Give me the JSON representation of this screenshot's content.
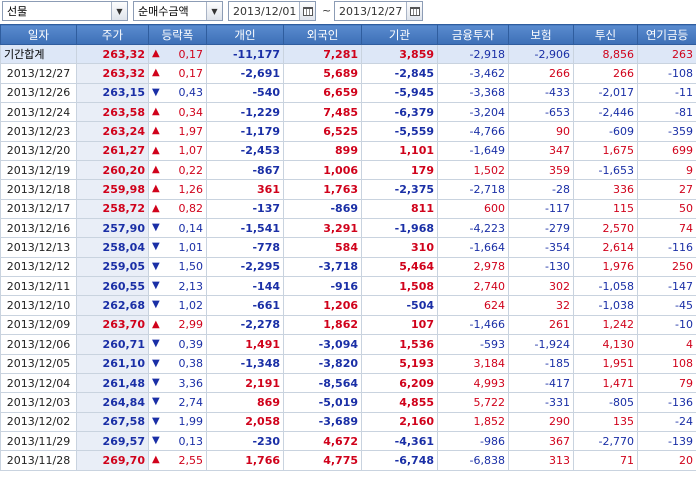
{
  "toolbar": {
    "market": "선물",
    "metric": "순매수금액",
    "date_from": "2013/12/01",
    "date_sep": "~",
    "date_to": "2013/12/27"
  },
  "columns": [
    "일자",
    "주가",
    "등락폭",
    "개인",
    "외국인",
    "기관",
    "금융투자",
    "보험",
    "투신",
    "연기금등"
  ],
  "total_row": {
    "date": "기간합계",
    "price": "263,32",
    "dir": "up",
    "chg": "0,17",
    "indiv": "-11,177",
    "foreign": "7,281",
    "inst": "3,859",
    "fin": "-2,918",
    "ins": "-2,906",
    "trust": "8,856",
    "pension": "263"
  },
  "rows": [
    {
      "date": "2013/12/27",
      "price": "263,32",
      "dir": "up",
      "chg": "0,17",
      "indiv": "-2,691",
      "foreign": "5,689",
      "inst": "-2,845",
      "fin": "-3,462",
      "ins": "266",
      "trust": "266",
      "pension": "-108"
    },
    {
      "date": "2013/12/26",
      "price": "263,15",
      "dir": "dn",
      "chg": "0,43",
      "indiv": "-540",
      "foreign": "6,659",
      "inst": "-5,945",
      "fin": "-3,368",
      "ins": "-433",
      "trust": "-2,017",
      "pension": "-11"
    },
    {
      "date": "2013/12/24",
      "price": "263,58",
      "dir": "up",
      "chg": "0,34",
      "indiv": "-1,229",
      "foreign": "7,485",
      "inst": "-6,379",
      "fin": "-3,204",
      "ins": "-653",
      "trust": "-2,446",
      "pension": "-81"
    },
    {
      "date": "2013/12/23",
      "price": "263,24",
      "dir": "up",
      "chg": "1,97",
      "indiv": "-1,179",
      "foreign": "6,525",
      "inst": "-5,559",
      "fin": "-4,766",
      "ins": "90",
      "trust": "-609",
      "pension": "-359"
    },
    {
      "date": "2013/12/20",
      "price": "261,27",
      "dir": "up",
      "chg": "1,07",
      "indiv": "-2,453",
      "foreign": "899",
      "inst": "1,101",
      "fin": "-1,649",
      "ins": "347",
      "trust": "1,675",
      "pension": "699"
    },
    {
      "date": "2013/12/19",
      "price": "260,20",
      "dir": "up",
      "chg": "0,22",
      "indiv": "-867",
      "foreign": "1,006",
      "inst": "179",
      "fin": "1,502",
      "ins": "359",
      "trust": "-1,653",
      "pension": "9"
    },
    {
      "date": "2013/12/18",
      "price": "259,98",
      "dir": "up",
      "chg": "1,26",
      "indiv": "361",
      "foreign": "1,763",
      "inst": "-2,375",
      "fin": "-2,718",
      "ins": "-28",
      "trust": "336",
      "pension": "27"
    },
    {
      "date": "2013/12/17",
      "price": "258,72",
      "dir": "up",
      "chg": "0,82",
      "indiv": "-137",
      "foreign": "-869",
      "inst": "811",
      "fin": "600",
      "ins": "-117",
      "trust": "115",
      "pension": "50"
    },
    {
      "date": "2013/12/16",
      "price": "257,90",
      "dir": "dn",
      "chg": "0,14",
      "indiv": "-1,541",
      "foreign": "3,291",
      "inst": "-1,968",
      "fin": "-4,223",
      "ins": "-279",
      "trust": "2,570",
      "pension": "74"
    },
    {
      "date": "2013/12/13",
      "price": "258,04",
      "dir": "dn",
      "chg": "1,01",
      "indiv": "-778",
      "foreign": "584",
      "inst": "310",
      "fin": "-1,664",
      "ins": "-354",
      "trust": "2,614",
      "pension": "-116"
    },
    {
      "date": "2013/12/12",
      "price": "259,05",
      "dir": "dn",
      "chg": "1,50",
      "indiv": "-2,295",
      "foreign": "-3,718",
      "inst": "5,464",
      "fin": "2,978",
      "ins": "-130",
      "trust": "1,976",
      "pension": "250"
    },
    {
      "date": "2013/12/11",
      "price": "260,55",
      "dir": "dn",
      "chg": "2,13",
      "indiv": "-144",
      "foreign": "-916",
      "inst": "1,508",
      "fin": "2,740",
      "ins": "302",
      "trust": "-1,058",
      "pension": "-147"
    },
    {
      "date": "2013/12/10",
      "price": "262,68",
      "dir": "dn",
      "chg": "1,02",
      "indiv": "-661",
      "foreign": "1,206",
      "inst": "-504",
      "fin": "624",
      "ins": "32",
      "trust": "-1,038",
      "pension": "-45"
    },
    {
      "date": "2013/12/09",
      "price": "263,70",
      "dir": "up",
      "chg": "2,99",
      "indiv": "-2,278",
      "foreign": "1,862",
      "inst": "107",
      "fin": "-1,466",
      "ins": "261",
      "trust": "1,242",
      "pension": "-10"
    },
    {
      "date": "2013/12/06",
      "price": "260,71",
      "dir": "dn",
      "chg": "0,39",
      "indiv": "1,491",
      "foreign": "-3,094",
      "inst": "1,536",
      "fin": "-593",
      "ins": "-1,924",
      "trust": "4,130",
      "pension": "4"
    },
    {
      "date": "2013/12/05",
      "price": "261,10",
      "dir": "dn",
      "chg": "0,38",
      "indiv": "-1,348",
      "foreign": "-3,820",
      "inst": "5,193",
      "fin": "3,184",
      "ins": "-185",
      "trust": "1,951",
      "pension": "108"
    },
    {
      "date": "2013/12/04",
      "price": "261,48",
      "dir": "dn",
      "chg": "3,36",
      "indiv": "2,191",
      "foreign": "-8,564",
      "inst": "6,209",
      "fin": "4,993",
      "ins": "-417",
      "trust": "1,471",
      "pension": "79"
    },
    {
      "date": "2013/12/03",
      "price": "264,84",
      "dir": "dn",
      "chg": "2,74",
      "indiv": "869",
      "foreign": "-5,019",
      "inst": "4,855",
      "fin": "5,722",
      "ins": "-331",
      "trust": "-805",
      "pension": "-136"
    },
    {
      "date": "2013/12/02",
      "price": "267,58",
      "dir": "dn",
      "chg": "1,99",
      "indiv": "2,058",
      "foreign": "-3,689",
      "inst": "2,160",
      "fin": "1,852",
      "ins": "290",
      "trust": "135",
      "pension": "-24"
    },
    {
      "date": "2013/11/29",
      "price": "269,57",
      "dir": "dn",
      "chg": "0,13",
      "indiv": "-230",
      "foreign": "4,672",
      "inst": "-4,361",
      "fin": "-986",
      "ins": "367",
      "trust": "-2,770",
      "pension": "-139"
    },
    {
      "date": "2013/11/28",
      "price": "269,70",
      "dir": "up",
      "chg": "2,55",
      "indiv": "1,766",
      "foreign": "4,775",
      "inst": "-6,748",
      "fin": "-6,838",
      "ins": "313",
      "trust": "71",
      "pension": "20"
    }
  ],
  "colors": {
    "up": "#d0021b",
    "down": "#1a2fa6",
    "header": "#3c6fb6"
  }
}
